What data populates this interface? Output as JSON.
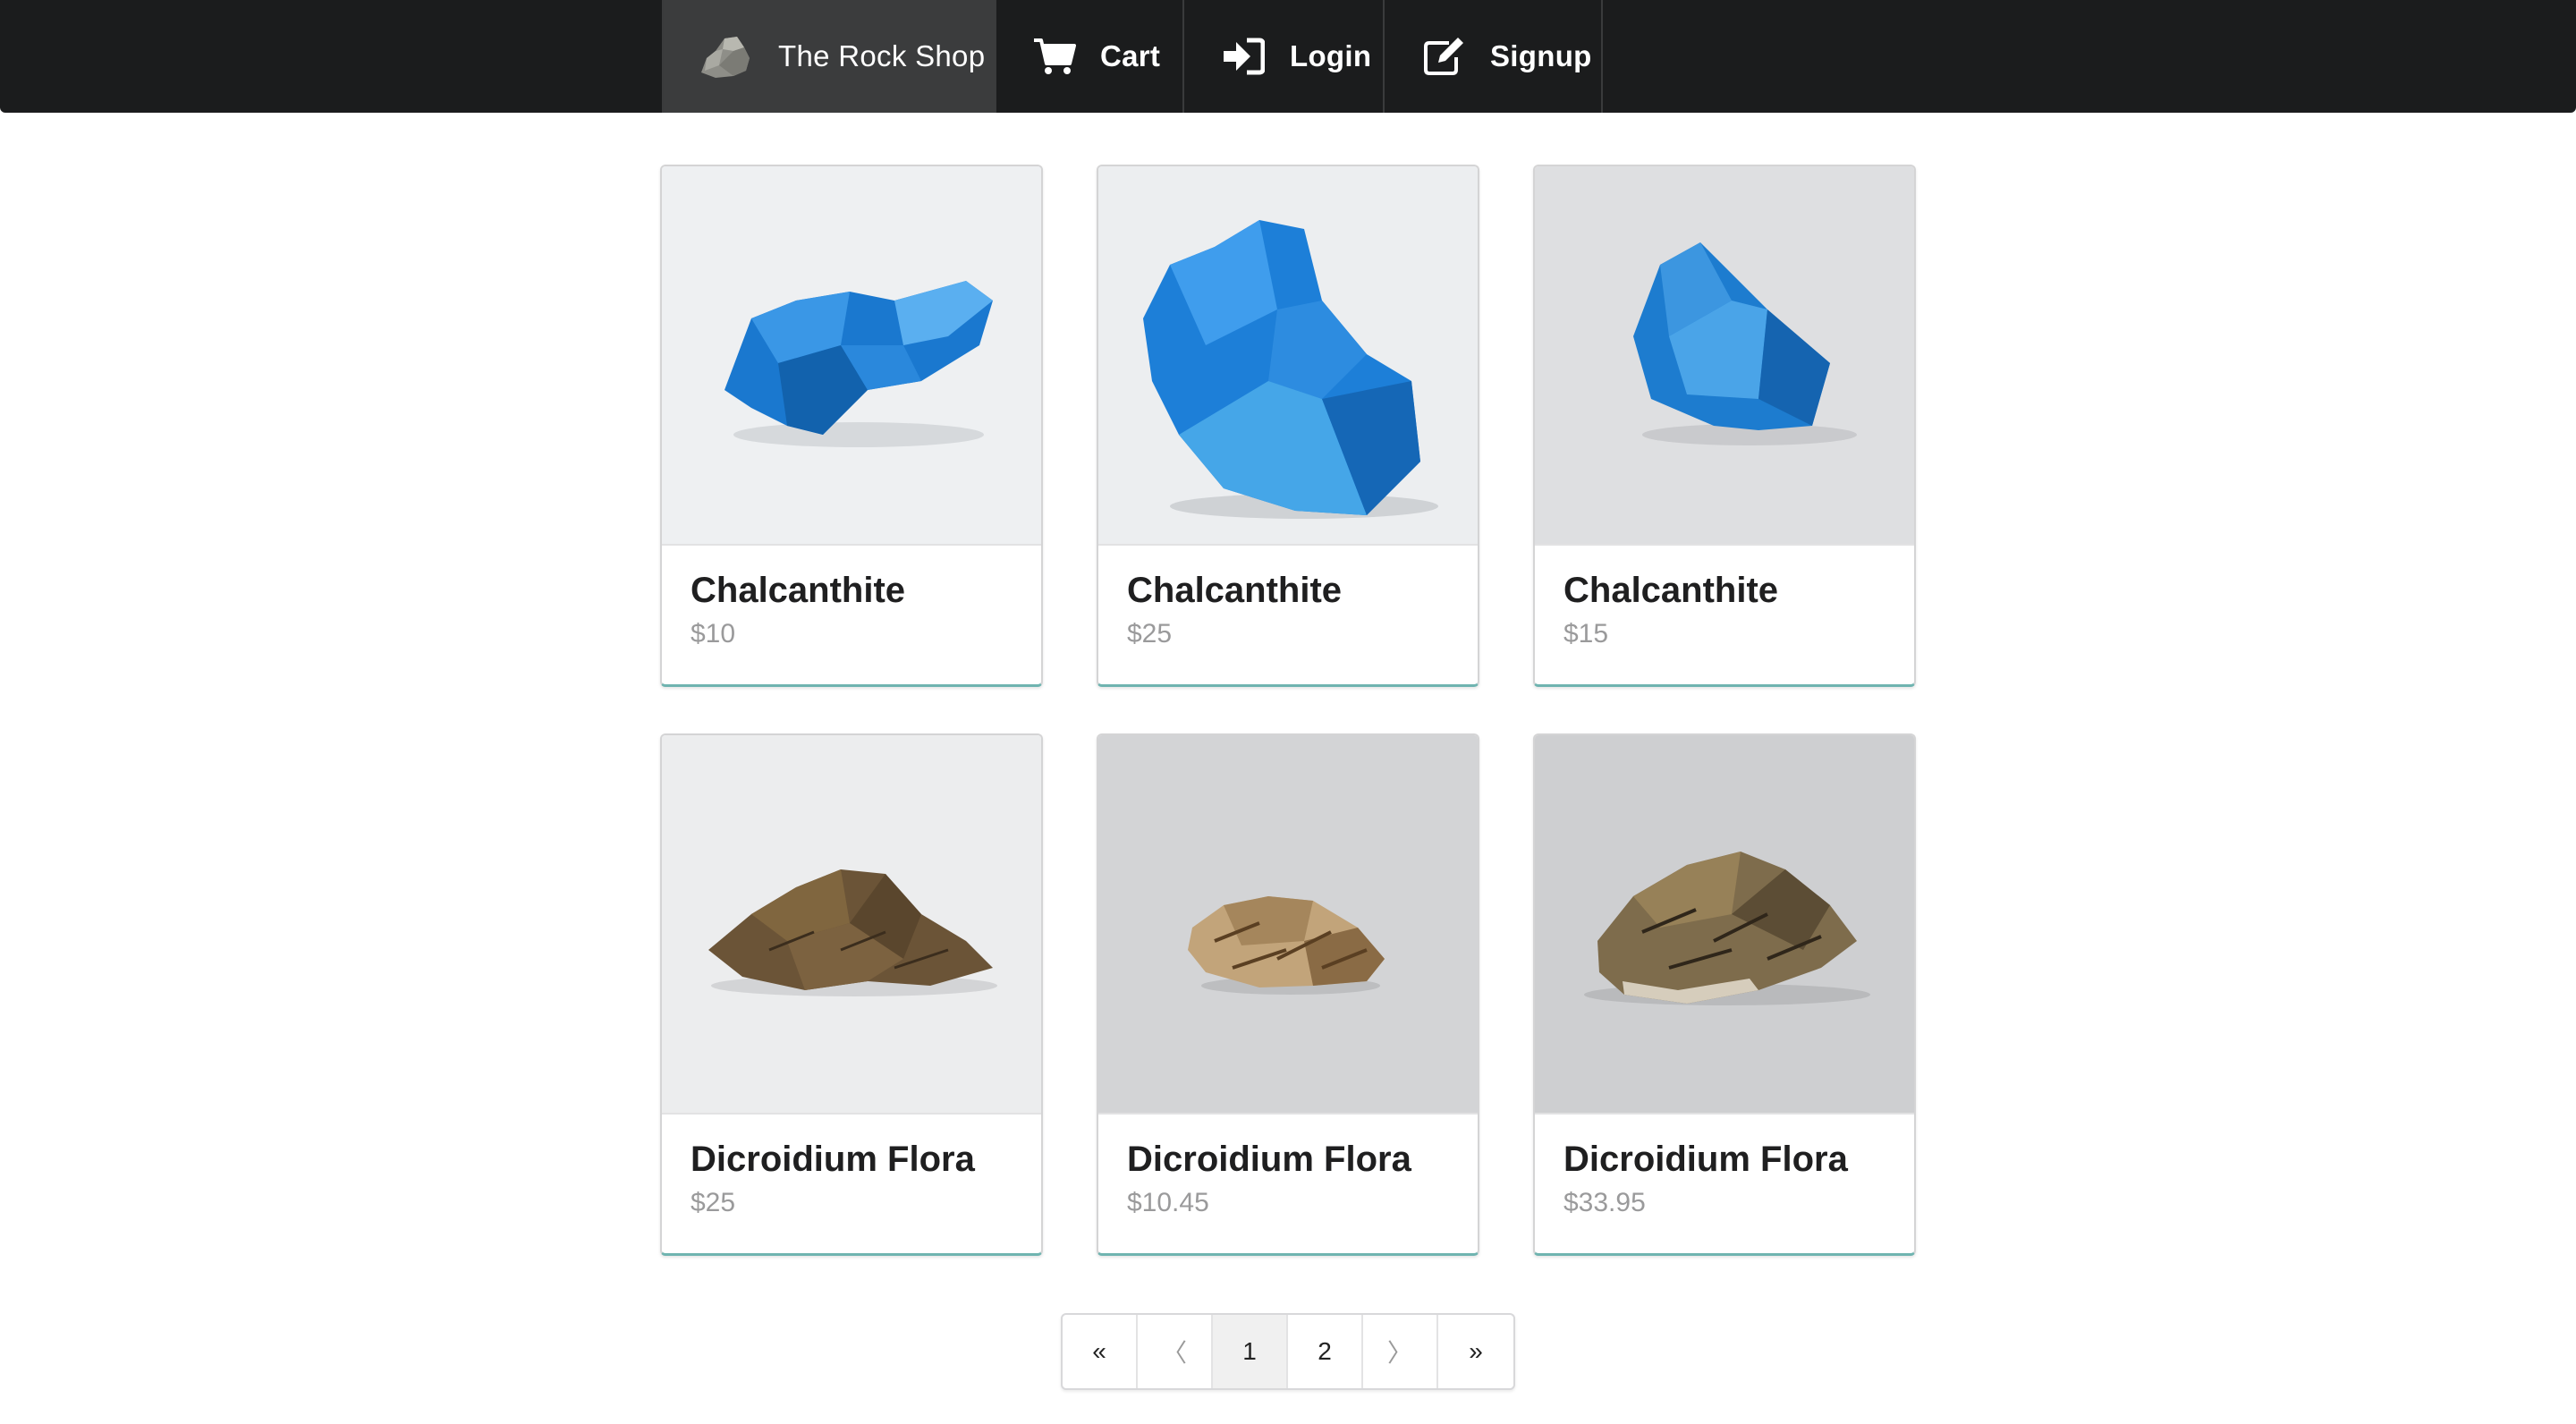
{
  "nav": {
    "brand": "The Rock Shop",
    "cart": "Cart",
    "login": "Login",
    "signup": "Signup"
  },
  "products": [
    {
      "name": "Chalcanthite",
      "price": "$10",
      "image": "blue-crystal"
    },
    {
      "name": "Chalcanthite",
      "price": "$25",
      "image": "blue-crystal"
    },
    {
      "name": "Chalcanthite",
      "price": "$15",
      "image": "blue-crystal"
    },
    {
      "name": "Dicroidium Flora",
      "price": "$25",
      "image": "brown-fossil"
    },
    {
      "name": "Dicroidium Flora",
      "price": "$10.45",
      "image": "brown-fossil"
    },
    {
      "name": "Dicroidium Flora",
      "price": "$33.95",
      "image": "brown-fossil"
    }
  ],
  "pagination": {
    "first": "«",
    "prev": "〈",
    "pages": [
      "1",
      "2"
    ],
    "current_page": "1",
    "next": "〉",
    "last": "»"
  },
  "colors": {
    "navbar": "#1b1c1d",
    "brand_active": "#3b3c3d",
    "card_accent": "#6fb4b0",
    "crystal_blue": "#1e7fd6",
    "fossil_brown": "#6b5437"
  }
}
